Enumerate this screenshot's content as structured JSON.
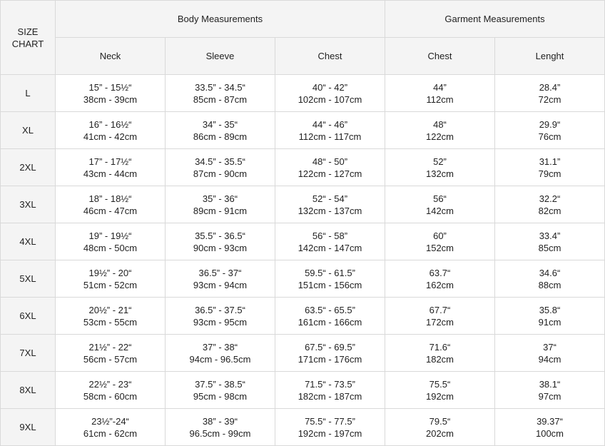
{
  "header": {
    "size_chart_line1": "SIZE",
    "size_chart_line2": "CHART",
    "body_group": "Body Measurements",
    "garment_group": "Garment Measurements",
    "columns": [
      "Neck",
      "Sleeve",
      "Chest",
      "Chest",
      "Lenght"
    ]
  },
  "rows": [
    {
      "size": "L",
      "cells": [
        [
          "15” - 15½“",
          "38cm - 39cm"
        ],
        [
          "33.5” - 34.5“",
          "85cm - 87cm"
        ],
        [
          "40“ - 42”",
          "102cm - 107cm"
        ],
        [
          "44”",
          "112cm"
        ],
        [
          "28.4”",
          "72cm"
        ]
      ]
    },
    {
      "size": "XL",
      "cells": [
        [
          "16” - 16½“",
          "41cm - 42cm"
        ],
        [
          "34” - 35“",
          "86cm - 89cm"
        ],
        [
          "44“ - 46”",
          "112cm - 117cm"
        ],
        [
          "48“",
          "122cm"
        ],
        [
          "29.9“",
          "76cm"
        ]
      ]
    },
    {
      "size": "2XL",
      "cells": [
        [
          "17” - 17½“",
          "43cm - 44cm"
        ],
        [
          "34.5” - 35.5“",
          "87cm - 90cm"
        ],
        [
          "48“ - 50”",
          "122cm - 127cm"
        ],
        [
          "52”",
          "132cm"
        ],
        [
          "31.1”",
          "79cm"
        ]
      ]
    },
    {
      "size": "3XL",
      "cells": [
        [
          "18” - 18½“",
          "46cm - 47cm"
        ],
        [
          "35” - 36“",
          "89cm - 91cm"
        ],
        [
          "52“ - 54”",
          "132cm - 137cm"
        ],
        [
          "56“",
          "142cm"
        ],
        [
          "32.2“",
          "82cm"
        ]
      ]
    },
    {
      "size": "4XL",
      "cells": [
        [
          "19” - 19½“",
          "48cm - 50cm"
        ],
        [
          "35.5” - 36.5“",
          "90cm - 93cm"
        ],
        [
          "56“ - 58”",
          "142cm - 147cm"
        ],
        [
          "60”",
          "152cm"
        ],
        [
          "33.4”",
          "85cm"
        ]
      ]
    },
    {
      "size": "5XL",
      "cells": [
        [
          "19½” - 20“",
          "51cm - 52cm"
        ],
        [
          "36.5” - 37“",
          "93cm - 94cm"
        ],
        [
          "59.5“ - 61.5”",
          "151cm - 156cm"
        ],
        [
          "63.7“",
          "162cm"
        ],
        [
          "34.6“",
          "88cm"
        ]
      ]
    },
    {
      "size": "6XL",
      "cells": [
        [
          "20½” - 21“",
          "53cm - 55cm"
        ],
        [
          "36.5” - 37.5“",
          "93cm - 95cm"
        ],
        [
          "63.5“ - 65.5”",
          "161cm - 166cm"
        ],
        [
          "67.7“",
          "172cm"
        ],
        [
          "35.8“",
          "91cm"
        ]
      ]
    },
    {
      "size": "7XL",
      "cells": [
        [
          "21½” - 22“",
          "56cm - 57cm"
        ],
        [
          "37” - 38“",
          "94cm - 96.5cm"
        ],
        [
          "67.5“ - 69.5”",
          "171cm - 176cm"
        ],
        [
          "71.6“",
          "182cm"
        ],
        [
          "37“",
          "94cm"
        ]
      ]
    },
    {
      "size": "8XL",
      "cells": [
        [
          "22½” - 23“",
          "58cm - 60cm"
        ],
        [
          "37.5” - 38.5“",
          "95cm - 98cm"
        ],
        [
          "71.5“ - 73.5”",
          "182cm - 187cm"
        ],
        [
          "75.5“",
          "192cm"
        ],
        [
          "38.1“",
          "97cm"
        ]
      ]
    },
    {
      "size": "9XL",
      "cells": [
        [
          "23½”-24“",
          "61cm - 62cm"
        ],
        [
          "38” - 39“",
          "96.5cm - 99cm"
        ],
        [
          "75.5“ - 77.5”",
          "192cm - 197cm"
        ],
        [
          "79.5“",
          "202cm"
        ],
        [
          "39.37“",
          "100cm"
        ]
      ]
    }
  ]
}
